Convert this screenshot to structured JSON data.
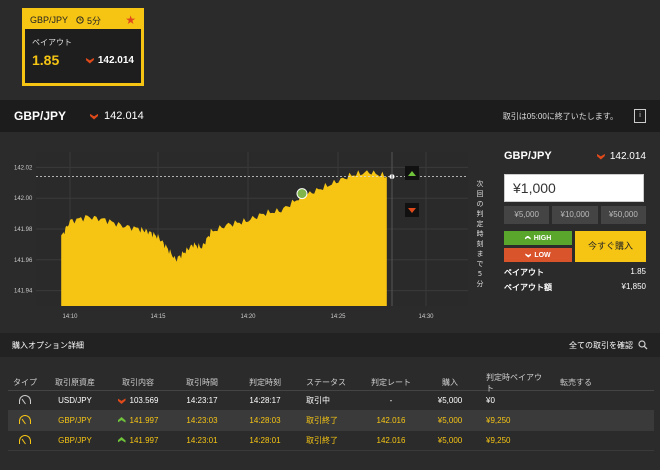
{
  "card": {
    "pair": "GBP/JPY",
    "duration": "5分",
    "payout_label": "ペイアウト",
    "payout": "1.85",
    "rate": "142.014"
  },
  "pairbar": {
    "pair": "GBP/JPY",
    "rate": "142.014",
    "notice": "取引は05:00に終了いたします。",
    "doc_icon": "i"
  },
  "chart_data": {
    "type": "area",
    "y_ticks": [
      "142.02",
      "142.00",
      "141.98",
      "141.96",
      "141.94"
    ],
    "x_ticks": [
      "14:10",
      "14:15",
      "14:20",
      "14:25",
      "14:30"
    ],
    "current_line": 142.014,
    "side_label": "次回の判定時刻まで5分",
    "ylim": [
      141.93,
      142.03
    ],
    "series": [
      {
        "x": "14:09.5",
        "y": 141.975
      },
      {
        "x": "14:10",
        "y": 141.985
      },
      {
        "x": "14:11",
        "y": 141.988
      },
      {
        "x": "14:12",
        "y": 141.986
      },
      {
        "x": "14:13",
        "y": 141.982
      },
      {
        "x": "14:14",
        "y": 141.98
      },
      {
        "x": "14:14.5",
        "y": 141.978
      },
      {
        "x": "14:15",
        "y": 141.975
      },
      {
        "x": "14:15.5",
        "y": 141.968
      },
      {
        "x": "14:16",
        "y": 141.96
      },
      {
        "x": "14:16.5",
        "y": 141.965
      },
      {
        "x": "14:17",
        "y": 141.97
      },
      {
        "x": "14:17.5",
        "y": 141.968
      },
      {
        "x": "14:18",
        "y": 141.978
      },
      {
        "x": "14:19",
        "y": 141.983
      },
      {
        "x": "14:20",
        "y": 141.985
      },
      {
        "x": "14:21",
        "y": 141.99
      },
      {
        "x": "14:22",
        "y": 141.992
      },
      {
        "x": "14:23",
        "y": 142.0
      },
      {
        "x": "14:24",
        "y": 142.005
      },
      {
        "x": "14:25",
        "y": 142.01
      },
      {
        "x": "14:26",
        "y": 142.015
      },
      {
        "x": "14:27",
        "y": 142.017
      },
      {
        "x": "14:28",
        "y": 142.014
      }
    ]
  },
  "bet": {
    "pair": "GBP/JPY",
    "rate": "142.014",
    "amount": "¥1,000",
    "quick": [
      "¥5,000",
      "¥10,000",
      "¥50,000"
    ],
    "high": "HIGH",
    "low": "LOW",
    "buy": "今すぐ購入",
    "payout_label": "ペイアウト",
    "payout": "1.85",
    "payout_amount_label": "ペイアウト額",
    "payout_amount": "¥1,850"
  },
  "options": {
    "title": "購入オプション詳細",
    "link": "全ての取引を確認"
  },
  "table": {
    "headers": [
      "タイプ",
      "取引原資産",
      "取引内容",
      "取引時間",
      "判定時刻",
      "ステータス",
      "判定レート",
      "購入",
      "判定時ペイアウト",
      "転売する"
    ],
    "rows": [
      {
        "asset": "USD/JPY",
        "dir": "down",
        "rate": "103.569",
        "time": "14:23:17",
        "expiry": "14:28:17",
        "status": "取引中",
        "close": "-",
        "buy": "¥5,000",
        "payout": "¥0",
        "done": false
      },
      {
        "asset": "GBP/JPY",
        "dir": "up",
        "rate": "141.997",
        "time": "14:23:03",
        "expiry": "14:28:03",
        "status": "取引終了",
        "close": "142.016",
        "buy": "¥5,000",
        "payout": "¥9,250",
        "done": true
      },
      {
        "asset": "GBP/JPY",
        "dir": "up",
        "rate": "141.997",
        "time": "14:23:01",
        "expiry": "14:28:01",
        "status": "取引終了",
        "close": "142.016",
        "buy": "¥5,000",
        "payout": "¥9,250",
        "done": true
      }
    ]
  },
  "colors": {
    "accent": "#f6c514",
    "up": "#6fc23a",
    "down": "#e04a1b"
  }
}
